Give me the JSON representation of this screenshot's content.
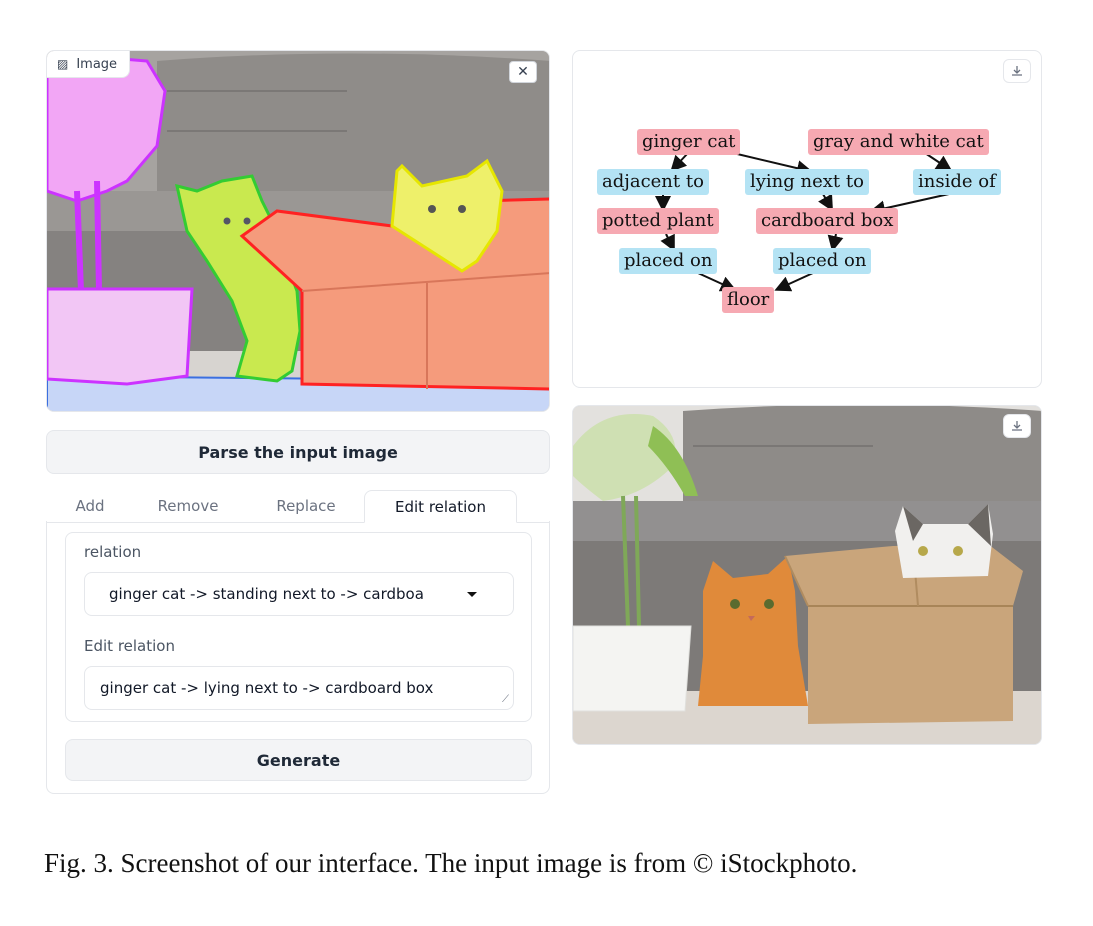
{
  "input_image": {
    "label": "Image",
    "close_symbol": "✕",
    "segments": [
      {
        "name": "potted plant",
        "color": "#cc33ff"
      },
      {
        "name": "ginger cat",
        "color": "#33cc33"
      },
      {
        "name": "gray and white cat",
        "color": "#e6e600"
      },
      {
        "name": "cardboard box",
        "color": "#ff2222"
      },
      {
        "name": "floor",
        "color": "#3b6fe0"
      }
    ]
  },
  "parse_button": {
    "label": "Parse the input image"
  },
  "tabs": [
    {
      "label": "Add"
    },
    {
      "label": "Remove"
    },
    {
      "label": "Replace"
    },
    {
      "label": "Edit relation",
      "active": true
    }
  ],
  "form": {
    "relation_label": "relation",
    "relation_value": "ginger cat -> standing next to -> cardboa",
    "edit_label": "Edit relation",
    "edit_value": "ginger cat -> lying next to -> cardboard box",
    "generate_label": "Generate"
  },
  "scene_graph": {
    "nodes": {
      "ginger_cat": "ginger cat",
      "gray_white_cat": "gray and white cat",
      "adjacent_to": "adjacent to",
      "lying_next_to": "lying next to",
      "inside_of": "inside of",
      "potted_plant": "potted plant",
      "cardboard_box": "cardboard box",
      "placed_on_1": "placed on",
      "placed_on_2": "placed on",
      "floor": "floor"
    },
    "entity_color": "#f6a9b2",
    "relation_color": "#b4e3f4"
  },
  "caption": "Fig. 3.  Screenshot of our interface. The input image is from © iStockphoto."
}
